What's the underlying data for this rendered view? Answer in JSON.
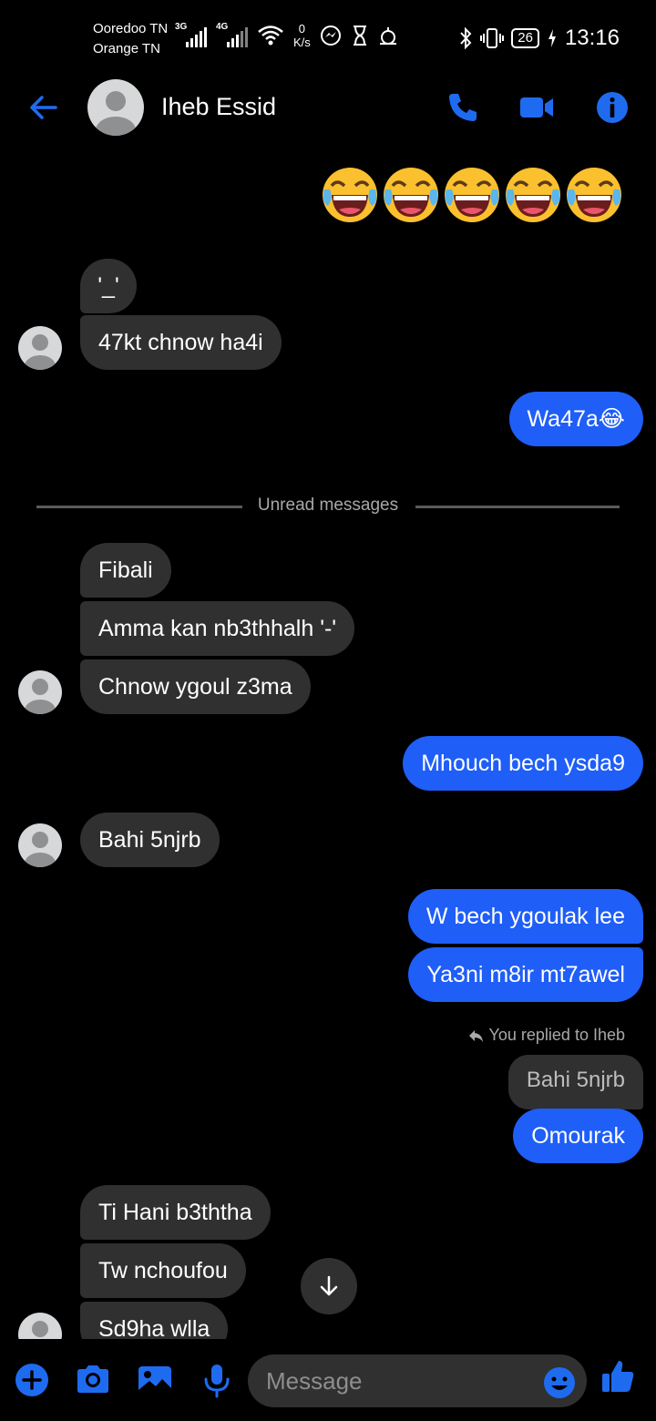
{
  "status_bar": {
    "carrier_1": "Ooredoo TN",
    "carrier_2": "Orange TN",
    "net_1": "3G",
    "net_2": "4G",
    "speed_value": "0",
    "speed_unit": "K/s",
    "battery": "26",
    "time": "13:16"
  },
  "header": {
    "contact_name": "Iheb Essid",
    "icons": [
      "back-arrow-icon",
      "phone-icon",
      "video-camera-icon",
      "info-icon"
    ],
    "accent_color": "#1f6bf0"
  },
  "messages": {
    "emoji_row": [
      "😂",
      "😂",
      "😂",
      "😂",
      "😂"
    ],
    "in_1": "'_'",
    "in_2": "47kt chnow ha4i",
    "out_1": "Wa47a😂",
    "unread_label": "Unread messages",
    "in_3": "Fibali",
    "in_4": "Amma kan nb3thhalh '-'",
    "in_5": "Chnow ygoul z3ma",
    "out_2": "Mhouch bech ysda9",
    "in_6": "Bahi 5njrb",
    "out_3": "W bech ygoulak lee",
    "out_4": "Ya3ni m8ir mt7awel",
    "replied_label": "You replied to Iheb",
    "quoted": "Bahi 5njrb",
    "out_5": "Omourak",
    "in_7": "Ti Hani b3ththa",
    "in_8": "Tw nchoufou",
    "in_9": "Sd9ha wlla"
  },
  "composer": {
    "placeholder": "Message",
    "icons": [
      "plus-icon",
      "camera-icon",
      "gallery-icon",
      "microphone-icon",
      "emoji-icon",
      "thumbs-up-icon"
    ]
  },
  "colors": {
    "outgoing_bubble": "#1f5ef7",
    "incoming_bubble": "#303030",
    "background": "#000000"
  }
}
